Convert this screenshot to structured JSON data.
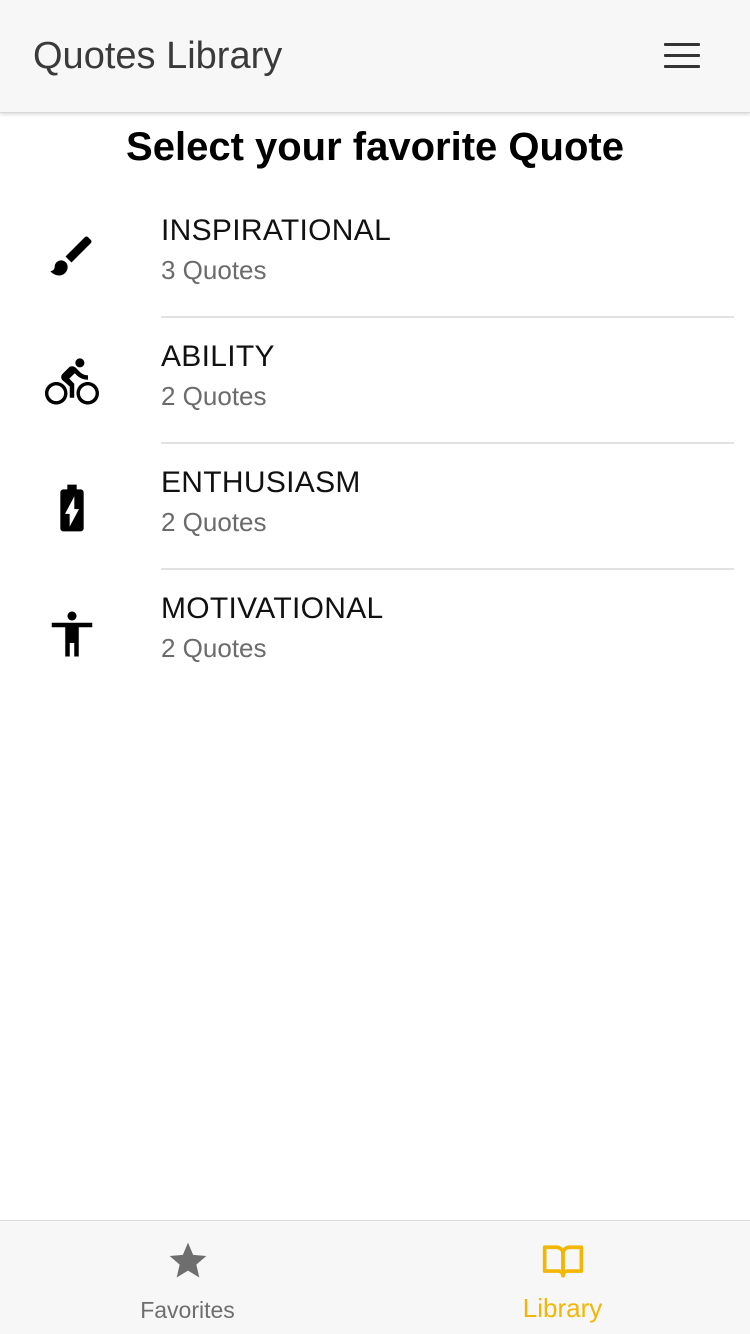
{
  "header": {
    "title": "Quotes Library",
    "menu_icon": "hamburger-menu-icon"
  },
  "page": {
    "heading": "Select your favorite Quote"
  },
  "categories": [
    {
      "title": "INSPIRATIONAL",
      "count_label": "3 Quotes",
      "icon": "paintbrush-icon"
    },
    {
      "title": "ABILITY",
      "count_label": "2 Quotes",
      "icon": "bike-icon"
    },
    {
      "title": "ENTHUSIASM",
      "count_label": "2 Quotes",
      "icon": "battery-charging-icon"
    },
    {
      "title": "MOTIVATIONAL",
      "count_label": "2 Quotes",
      "icon": "accessibility-icon"
    }
  ],
  "tabs": [
    {
      "label": "Favorites",
      "icon": "star-icon",
      "active": false
    },
    {
      "label": "Library",
      "icon": "book-open-icon",
      "active": true
    }
  ],
  "colors": {
    "accent": "#f2b705",
    "inactive": "#6e6e6e",
    "header_bg": "#f7f7f7"
  }
}
